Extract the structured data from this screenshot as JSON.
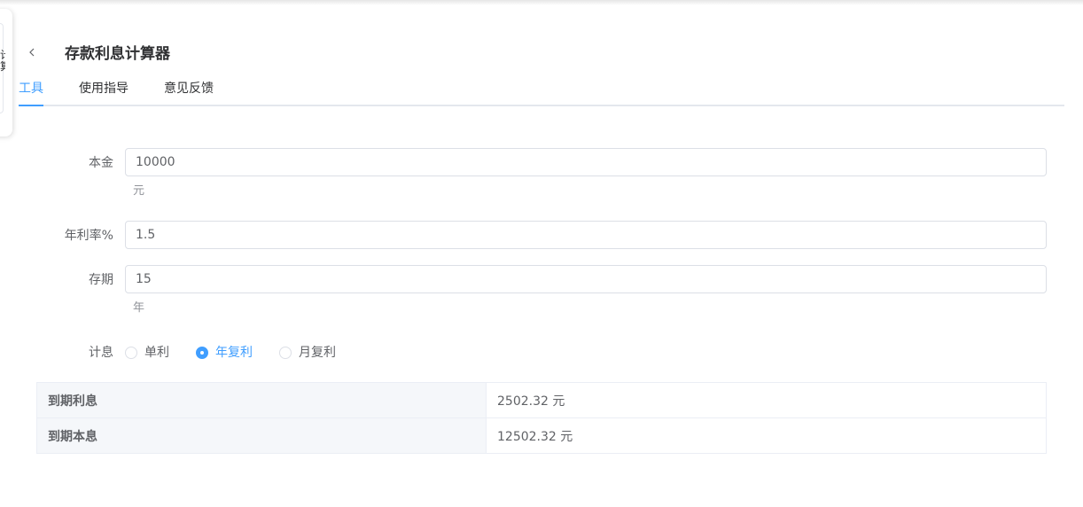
{
  "page": {
    "title": "存款利息计算器",
    "side_fragment": "计算"
  },
  "tabs": [
    {
      "label": "工具",
      "active": true
    },
    {
      "label": "使用指导",
      "active": false
    },
    {
      "label": "意见反馈",
      "active": false
    }
  ],
  "form": {
    "principal": {
      "label": "本金",
      "value": "10000",
      "unit": "元"
    },
    "rate": {
      "label": "年利率%",
      "value": "1.5"
    },
    "term": {
      "label": "存期",
      "value": "15",
      "unit": "年"
    },
    "interest_type": {
      "label": "计息",
      "options": [
        {
          "label": "单利",
          "checked": false
        },
        {
          "label": "年复利",
          "checked": true
        },
        {
          "label": "月复利",
          "checked": false
        }
      ]
    }
  },
  "result": {
    "rows": [
      {
        "key": "到期利息",
        "value": "2502.32 元"
      },
      {
        "key": "到期本息",
        "value": "12502.32 元"
      }
    ]
  },
  "colors": {
    "accent": "#409eff",
    "border": "#dcdfe6",
    "header_bg": "#f5f7fa"
  },
  "icons": {
    "back": "chevron-left-icon"
  }
}
